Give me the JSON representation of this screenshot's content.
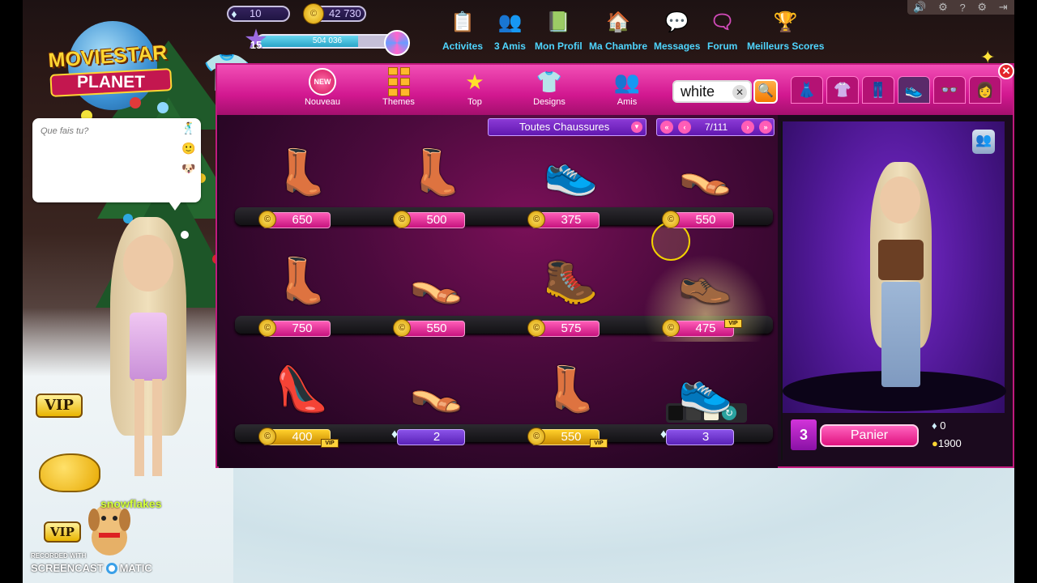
{
  "logo": {
    "line1": "MOVIESTAR",
    "line2": "PLANET"
  },
  "stats": {
    "diamonds": "10",
    "coins": "42 730",
    "level": "15",
    "xp": "504 036",
    "xp_fraction": 0.72
  },
  "topnav": [
    {
      "label": "Activites",
      "icon": "clipboard-icon"
    },
    {
      "label": "3 Amis",
      "icon": "friends-icon"
    },
    {
      "label": "Mon Profil",
      "icon": "profile-book-icon"
    },
    {
      "label": "Ma Chambre",
      "icon": "house-icon"
    },
    {
      "label": "Messages",
      "icon": "chat-bubbles-icon"
    },
    {
      "label": "Forum",
      "icon": "forum-icon"
    },
    {
      "label": "Meilleurs Scores",
      "icon": "trophy-icon"
    }
  ],
  "chat": {
    "placeholder": "Que fais tu?"
  },
  "shop": {
    "tabs": [
      {
        "label": "Nouveau",
        "badge": "NEW"
      },
      {
        "label": "Themes"
      },
      {
        "label": "Top"
      },
      {
        "label": "Designs"
      },
      {
        "label": "Amis"
      }
    ],
    "search_value": "white",
    "filter": "Toutes Chaussures",
    "page": "7/111",
    "items": [
      {
        "price": "650",
        "currency": "coins",
        "vip": false,
        "color": "#c68be8",
        "glyph": "👢"
      },
      {
        "price": "500",
        "currency": "coins",
        "vip": false,
        "color": "#2b2b2b",
        "glyph": "👢"
      },
      {
        "price": "375",
        "currency": "coins",
        "vip": false,
        "color": "#f2f2f2",
        "glyph": "👟"
      },
      {
        "price": "550",
        "currency": "coins",
        "vip": false,
        "color": "#f5f5f5",
        "glyph": "👡"
      },
      {
        "price": "750",
        "currency": "coins",
        "vip": false,
        "color": "#f1c7e6",
        "glyph": "👢"
      },
      {
        "price": "550",
        "currency": "coins",
        "vip": false,
        "color": "#f7c3d6",
        "glyph": "👡"
      },
      {
        "price": "575",
        "currency": "coins",
        "vip": false,
        "color": "#232323",
        "glyph": "🥾"
      },
      {
        "price": "475",
        "currency": "coins",
        "vip": false,
        "color": "#1e1e1e",
        "glyph": "👞",
        "vip_tag_text": "VIP"
      },
      {
        "price": "400",
        "currency": "coins",
        "vip": true,
        "color": "#222222",
        "glyph": "👠"
      },
      {
        "price": "2",
        "currency": "diamonds",
        "vip": false,
        "color": "#c01b2a",
        "glyph": "👡"
      },
      {
        "price": "550",
        "currency": "coins",
        "vip": true,
        "color": "#c69656",
        "glyph": "👢"
      },
      {
        "price": "3",
        "currency": "diamonds",
        "vip": false,
        "color": "#e6eef8",
        "glyph": "👟"
      }
    ],
    "swatches": [
      "#111111",
      "#3a3a3a",
      "#f5f0d8"
    ],
    "vip_label": "VIP"
  },
  "cart": {
    "count": "3",
    "button": "Panier",
    "diamonds": "0",
    "coins": "1900"
  },
  "vip_badge": "VIP",
  "nickname": "snowflakes",
  "watermark": {
    "line1": "RECORDED WITH",
    "line2a": "SCREENCAST",
    "line2b": "MATIC"
  }
}
